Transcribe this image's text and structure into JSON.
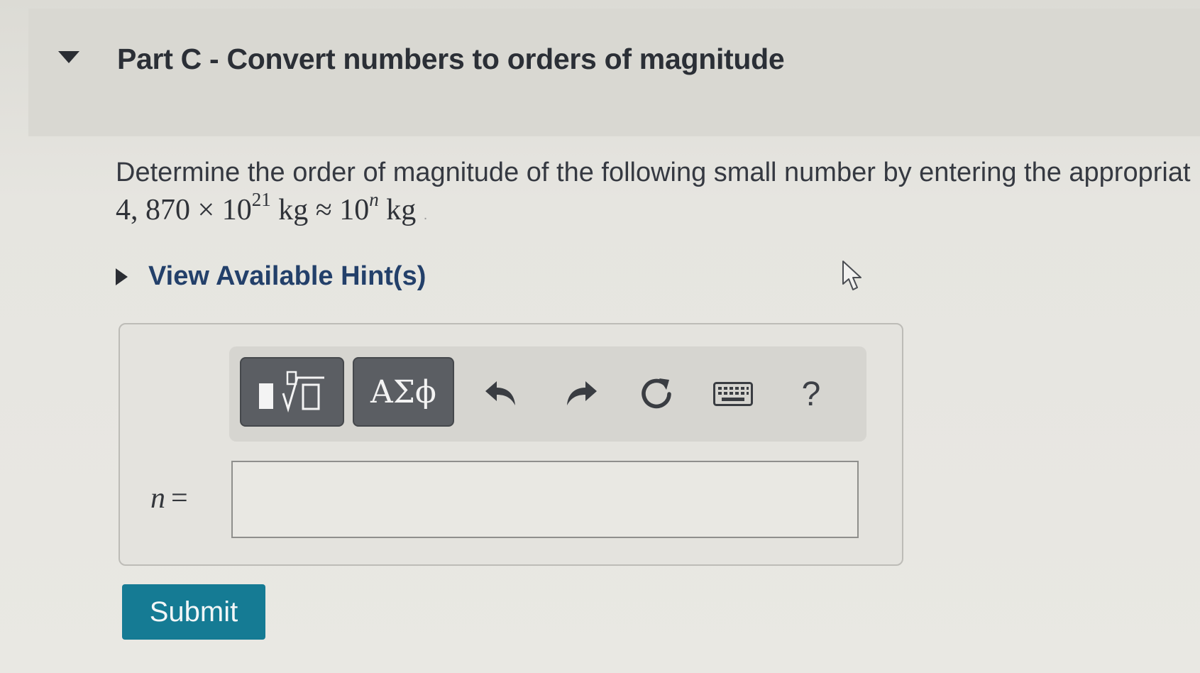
{
  "part": {
    "title": "Part C - Convert numbers to orders of magnitude",
    "expanded": true
  },
  "question": {
    "prompt": "Determine the order of magnitude of the following small number by entering the appropriat",
    "equation": {
      "mantissa": "4, 870",
      "times": "×",
      "base_left": "10",
      "exponent_left": "21",
      "unit_left": "kg",
      "approx": "≈",
      "base_right": "10",
      "exponent_right": "n",
      "unit_right": "kg",
      "trailing": "."
    }
  },
  "hint": {
    "label": "View Available Hint(s)",
    "expanded": false
  },
  "toolbar": {
    "templates_label": "templates-button",
    "symbols_label": "ΑΣϕ",
    "undo": "undo-icon",
    "redo": "redo-icon",
    "reset": "reset-icon",
    "keyboard": "keyboard-icon",
    "help_label": "?"
  },
  "answer": {
    "variable": "n",
    "equals": "=",
    "value": "",
    "placeholder": ""
  },
  "submit": {
    "label": "Submit",
    "color": "#157b94"
  }
}
